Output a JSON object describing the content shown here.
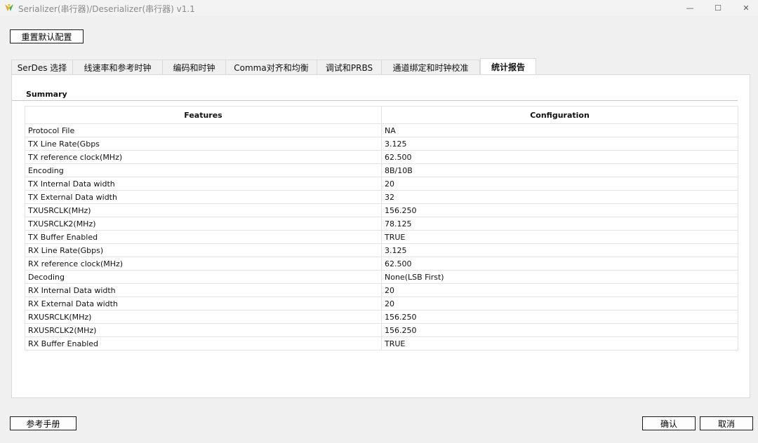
{
  "window": {
    "title": "Serializer(串行器)/Deserializer(串行器) v1.1",
    "minimize_glyph": "—",
    "maximize_glyph": "☐",
    "close_glyph": "✕"
  },
  "toolbar": {
    "reset_label": "重置默认配置"
  },
  "tabs": [
    {
      "label": "SerDes 选择"
    },
    {
      "label": "线速率和参考时钟"
    },
    {
      "label": "编码和时钟"
    },
    {
      "label": "Comma对齐和均衡"
    },
    {
      "label": "调试和PRBS"
    },
    {
      "label": "通道绑定和时钟校准"
    },
    {
      "label": "统计报告",
      "active": true
    }
  ],
  "summary": {
    "title": "Summary",
    "headers": {
      "features": "Features",
      "configuration": "Configuration"
    },
    "rows": [
      {
        "feature": "Protocol File",
        "value": "NA"
      },
      {
        "feature": "TX Line Rate(Gbps",
        "value": "3.125"
      },
      {
        "feature": "TX reference clock(MHz)",
        "value": "62.500"
      },
      {
        "feature": "Encoding",
        "value": "8B/10B"
      },
      {
        "feature": "TX Internal Data width",
        "value": "20"
      },
      {
        "feature": "TX External Data width",
        "value": "32"
      },
      {
        "feature": "TXUSRCLK(MHz)",
        "value": "156.250"
      },
      {
        "feature": "TXUSRCLK2(MHz)",
        "value": "78.125"
      },
      {
        "feature": "TX Buffer Enabled",
        "value": "TRUE"
      },
      {
        "feature": "RX Line Rate(Gbps)",
        "value": "3.125"
      },
      {
        "feature": "RX reference clock(MHz)",
        "value": "62.500"
      },
      {
        "feature": "Decoding",
        "value": "None(LSB First)"
      },
      {
        "feature": "RX Internal Data width",
        "value": "20"
      },
      {
        "feature": "RX External Data width",
        "value": "20"
      },
      {
        "feature": "RXUSRCLK(MHz)",
        "value": "156.250"
      },
      {
        "feature": "RXUSRCLK2(MHz)",
        "value": "156.250"
      },
      {
        "feature": "RX Buffer Enabled",
        "value": "TRUE"
      }
    ]
  },
  "footer": {
    "manual_label": "参考手册",
    "ok_label": "确认",
    "cancel_label": "取消"
  },
  "icons": {
    "app": "app-logo-icon"
  },
  "colors": {
    "window_bg": "#f0f0f0",
    "panel_bg": "#ffffff",
    "title_text": "#8a8a8a"
  }
}
